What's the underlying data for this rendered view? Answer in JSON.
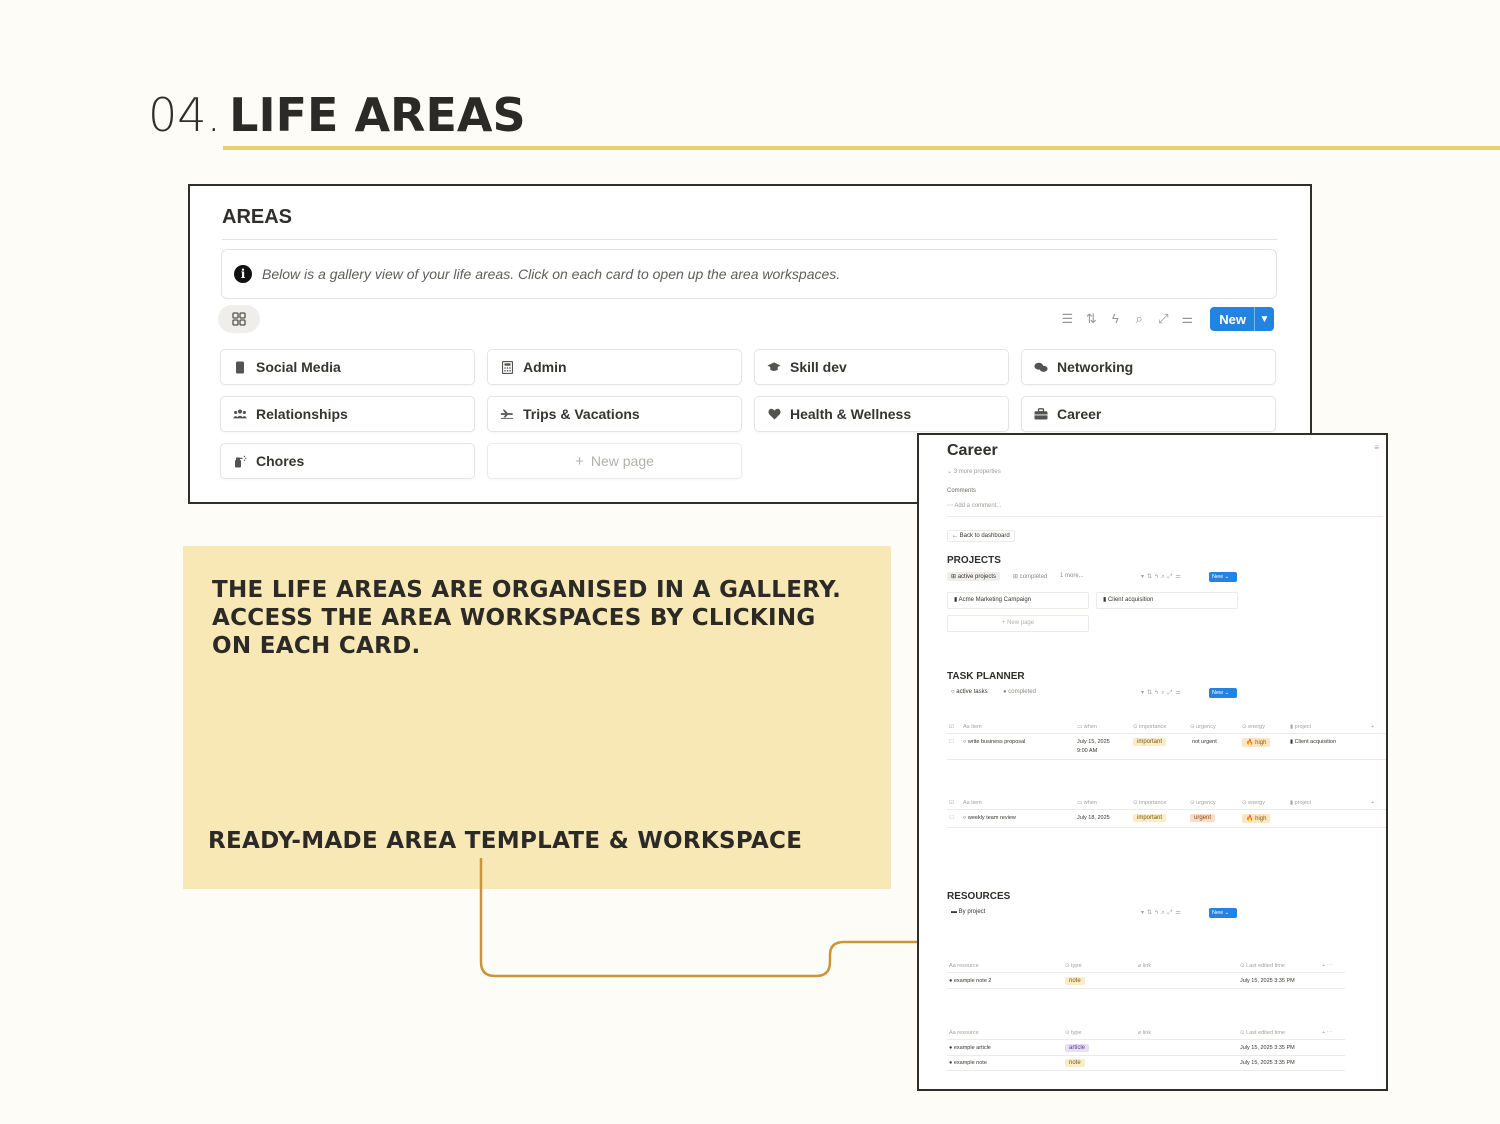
{
  "header": {
    "number": "04.",
    "title": "LIFE AREAS"
  },
  "areas": {
    "title": "AREAS",
    "callout": "Below is a gallery view of your life areas. Click on each card to open up the area workspaces.",
    "toolbar": {
      "new_label": "New"
    },
    "cards": [
      {
        "label": "Social Media",
        "icon": "phone-icon"
      },
      {
        "label": "Admin",
        "icon": "calculator-icon"
      },
      {
        "label": "Skill dev",
        "icon": "graduation-cap-icon"
      },
      {
        "label": "Networking",
        "icon": "chat-bubbles-icon"
      },
      {
        "label": "Relationships",
        "icon": "people-icon"
      },
      {
        "label": "Trips & Vacations",
        "icon": "plane-icon"
      },
      {
        "label": "Health & Wellness",
        "icon": "heart-icon"
      },
      {
        "label": "Career",
        "icon": "briefcase-icon"
      },
      {
        "label": "Chores",
        "icon": "spray-bottle-icon"
      }
    ],
    "new_page": "New page"
  },
  "promo": {
    "main": "THE LIFE AREAS ARE ORGANISED IN A GALLERY. ACCESS THE AREA WORKSPACES BY CLICKING ON EACH CARD.",
    "sub": "READY-MADE AREA TEMPLATE & WORKSPACE"
  },
  "career": {
    "title": "Career",
    "more_props": "3 more properties",
    "comments": "Comments",
    "add_comment": "Add a comment...",
    "back": "Back to dashboard",
    "projects": {
      "title": "PROJECTS",
      "tabs": [
        "active projects",
        "completed",
        "1 more..."
      ],
      "new": "New",
      "cards": [
        "Acme Marketing Campaign",
        "Client acquisition"
      ],
      "new_page": "New page"
    },
    "tasks": {
      "title": "TASK PLANNER",
      "tabs": [
        "active tasks",
        "completed"
      ],
      "new": "New",
      "headers": [
        "item",
        "when",
        "importance",
        "urgency",
        "energy",
        "project"
      ],
      "row1": {
        "item": "write business proposal",
        "when": "July 15, 2025",
        "time": "9:00 AM",
        "importance": "important",
        "urgency": "not urgent",
        "energy": "high",
        "project": "Client acquisition"
      },
      "row2": {
        "item": "weekly team review",
        "when": "July 18, 2025",
        "importance": "important",
        "urgency": "urgent",
        "energy": "high"
      }
    },
    "resources": {
      "title": "RESOURCES",
      "tab": "By project",
      "new": "New",
      "headers": [
        "resource",
        "type",
        "link",
        "Last edited time"
      ],
      "group1": [
        {
          "name": "example note 2",
          "type": "note",
          "time": "July 15, 2025 3:35 PM"
        }
      ],
      "group2": [
        {
          "name": "example article",
          "type": "article",
          "time": "July 15, 2025 3:35 PM"
        },
        {
          "name": "example note",
          "type": "note",
          "time": "July 15, 2025 3:35 PM"
        }
      ]
    }
  },
  "colors": {
    "accent": "#2383e2",
    "rule": "#e5cf6e",
    "promo_bg": "#f8e8b5",
    "connector": "#c9953a"
  }
}
